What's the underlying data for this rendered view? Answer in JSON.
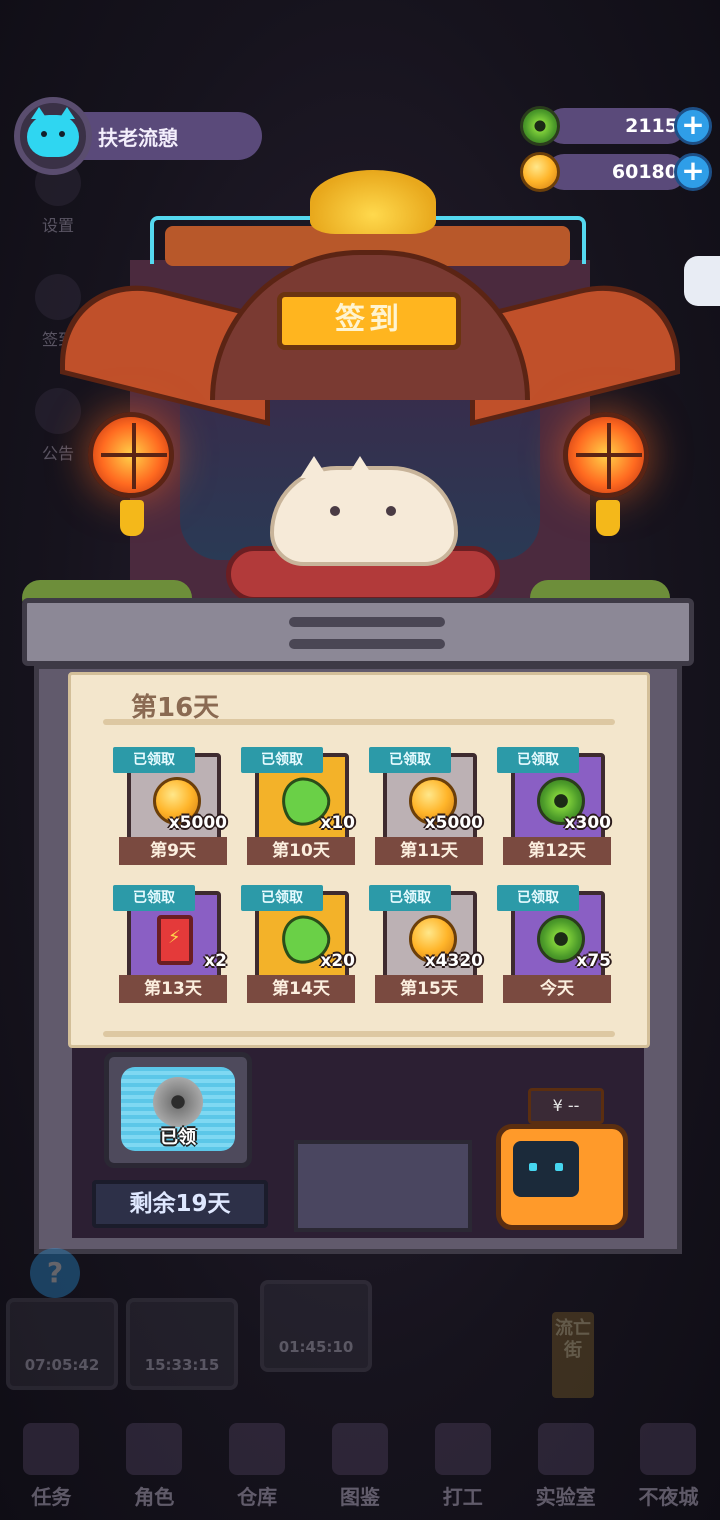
{
  "header": {
    "username": "扶老流憩",
    "currencies": [
      {
        "icon": "green-gem-icon",
        "value": "2115"
      },
      {
        "icon": "gold-coin-icon",
        "value": "60180"
      }
    ],
    "plus_label": "+"
  },
  "side_menu": [
    {
      "label": "设置",
      "icon": "gear-icon"
    },
    {
      "label": "签到",
      "icon": "checkin-icon"
    },
    {
      "label": "公告",
      "icon": "speaker-icon"
    }
  ],
  "shrine": {
    "sign": "签到"
  },
  "checkin": {
    "title": "第16天",
    "claimed_label": "已领取",
    "rewards": [
      {
        "day": "第9天",
        "qty": "x5000",
        "icon": "gold-coin-icon",
        "card": "gray"
      },
      {
        "day": "第10天",
        "qty": "x10",
        "icon": "green-leaf-icon",
        "card": "yellow"
      },
      {
        "day": "第11天",
        "qty": "x5000",
        "icon": "gold-coin-icon",
        "card": "gray"
      },
      {
        "day": "第12天",
        "qty": "x300",
        "icon": "green-gem-icon",
        "card": "purple"
      },
      {
        "day": "第13天",
        "qty": "x2",
        "icon": "battery-icon",
        "card": "purple"
      },
      {
        "day": "第14天",
        "qty": "x20",
        "icon": "green-leaf-icon",
        "card": "yellow"
      },
      {
        "day": "第15天",
        "qty": "x4320",
        "icon": "gold-coin-icon",
        "card": "gray"
      },
      {
        "day": "今天",
        "qty": "x75",
        "icon": "green-gem-icon",
        "card": "purple"
      }
    ]
  },
  "monthly_card": {
    "status": "已领",
    "remaining": "剩余19天"
  },
  "vending": {
    "price": "¥ --"
  },
  "background": {
    "timers": [
      "07:05:42",
      "15:33:15",
      "01:45:10"
    ],
    "street_label": "流亡街",
    "help_label": "?"
  },
  "nav": [
    {
      "label": "任务",
      "icon": "task-icon"
    },
    {
      "label": "角色",
      "icon": "character-icon"
    },
    {
      "label": "仓库",
      "icon": "warehouse-icon"
    },
    {
      "label": "图鉴",
      "icon": "book-icon"
    },
    {
      "label": "打工",
      "icon": "work-icon"
    },
    {
      "label": "实验室",
      "icon": "lab-icon"
    },
    {
      "label": "不夜城",
      "icon": "city-icon"
    }
  ],
  "colors": {
    "accent_cyan": "#2fd6f1",
    "claimed_badge": "#2c9aa8",
    "day_label": "#7a4a40",
    "sign_gold": "#ffb51f"
  }
}
